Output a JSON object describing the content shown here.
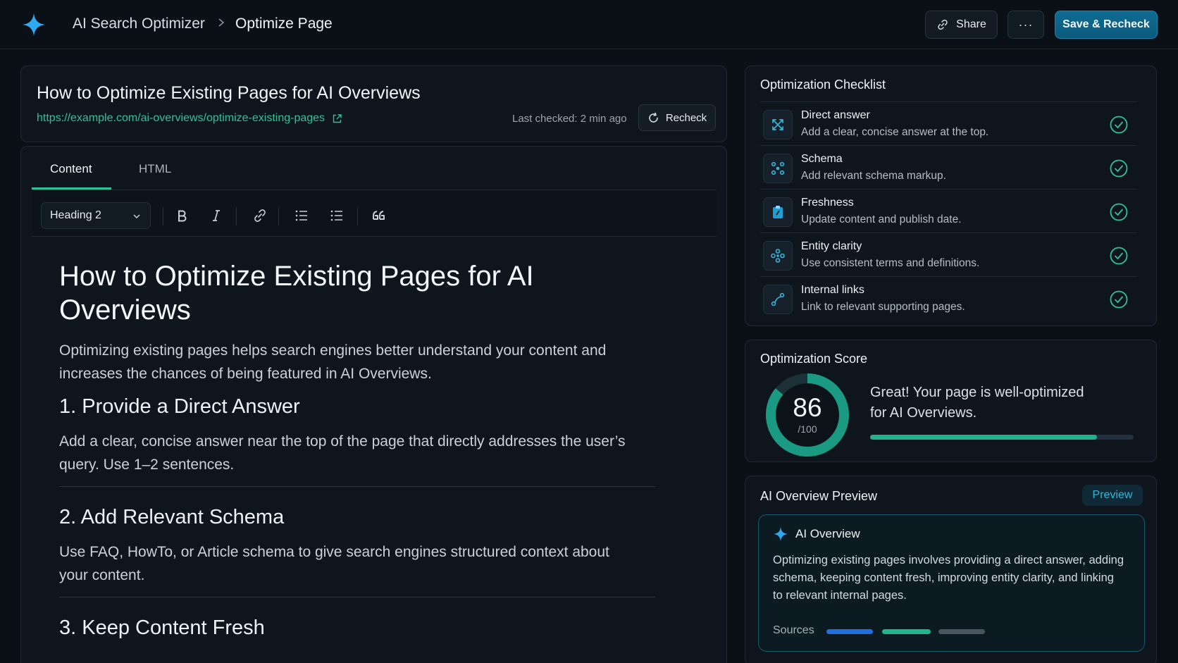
{
  "header": {
    "app_name": "AI Search Optimizer",
    "page_name": "Optimize Page",
    "share_label": "Share",
    "more_label": "···",
    "save_label": "Save & Recheck"
  },
  "page": {
    "title": "How to Optimize Existing Pages for AI Overviews",
    "url": "https://example.com/ai-overviews/optimize-existing-pages",
    "last_checked": "Last checked: 2 min ago",
    "recheck_label": "Recheck"
  },
  "editor": {
    "tabs": [
      {
        "label": "Content",
        "active": true
      },
      {
        "label": "HTML",
        "active": false
      }
    ],
    "format_value": "Heading 2",
    "document": {
      "h1": "How to Optimize Existing Pages for AI Overviews",
      "intro": "Optimizing existing pages helps search engines better understand your content and increases the chances of being featured in AI Overviews.",
      "sections": [
        {
          "heading": "1. Provide a Direct Answer",
          "body": "Add a clear, concise answer near the top of the page that directly addresses the user’s query. Use 1–2 sentences."
        },
        {
          "heading": "2. Add Relevant Schema",
          "body": "Use FAQ, HowTo, or Article schema to give search engines structured context about your content."
        },
        {
          "heading": "3. Keep Content Fresh",
          "body": ""
        }
      ]
    }
  },
  "checklist": {
    "title": "Optimization Checklist",
    "items": [
      {
        "title": "Direct answer",
        "desc": "Add a clear, concise answer at the top.",
        "icon": "expand-arrows-icon",
        "done": true
      },
      {
        "title": "Schema",
        "desc": "Add relevant schema markup.",
        "icon": "schema-nodes-icon",
        "done": true
      },
      {
        "title": "Freshness",
        "desc": "Update content and publish date.",
        "icon": "clipboard-icon",
        "done": true
      },
      {
        "title": "Entity clarity",
        "desc": "Use consistent terms and definitions.",
        "icon": "entity-cluster-icon",
        "done": true
      },
      {
        "title": "Internal links",
        "desc": "Link to relevant supporting pages.",
        "icon": "link-path-icon",
        "done": true
      }
    ]
  },
  "score": {
    "title": "Optimization Score",
    "value": "86",
    "max_label": "/100",
    "fraction": 0.86,
    "message": "Great! Your page is well-optimized for AI Overviews."
  },
  "preview": {
    "title": "AI Overview Preview",
    "badge": "Preview",
    "overview_label": "AI Overview",
    "text": "Optimizing existing pages involves providing a direct answer, adding schema, keeping content fresh, improving entity clarity, and linking to relevant internal pages.",
    "sources_label": "Sources",
    "source_colors": [
      "#1f6fe0",
      "#1fb58f",
      "#4a5561"
    ]
  },
  "colors": {
    "accent": "#2bc39a",
    "brand": "#35b5d8",
    "background": "#0b1016"
  }
}
